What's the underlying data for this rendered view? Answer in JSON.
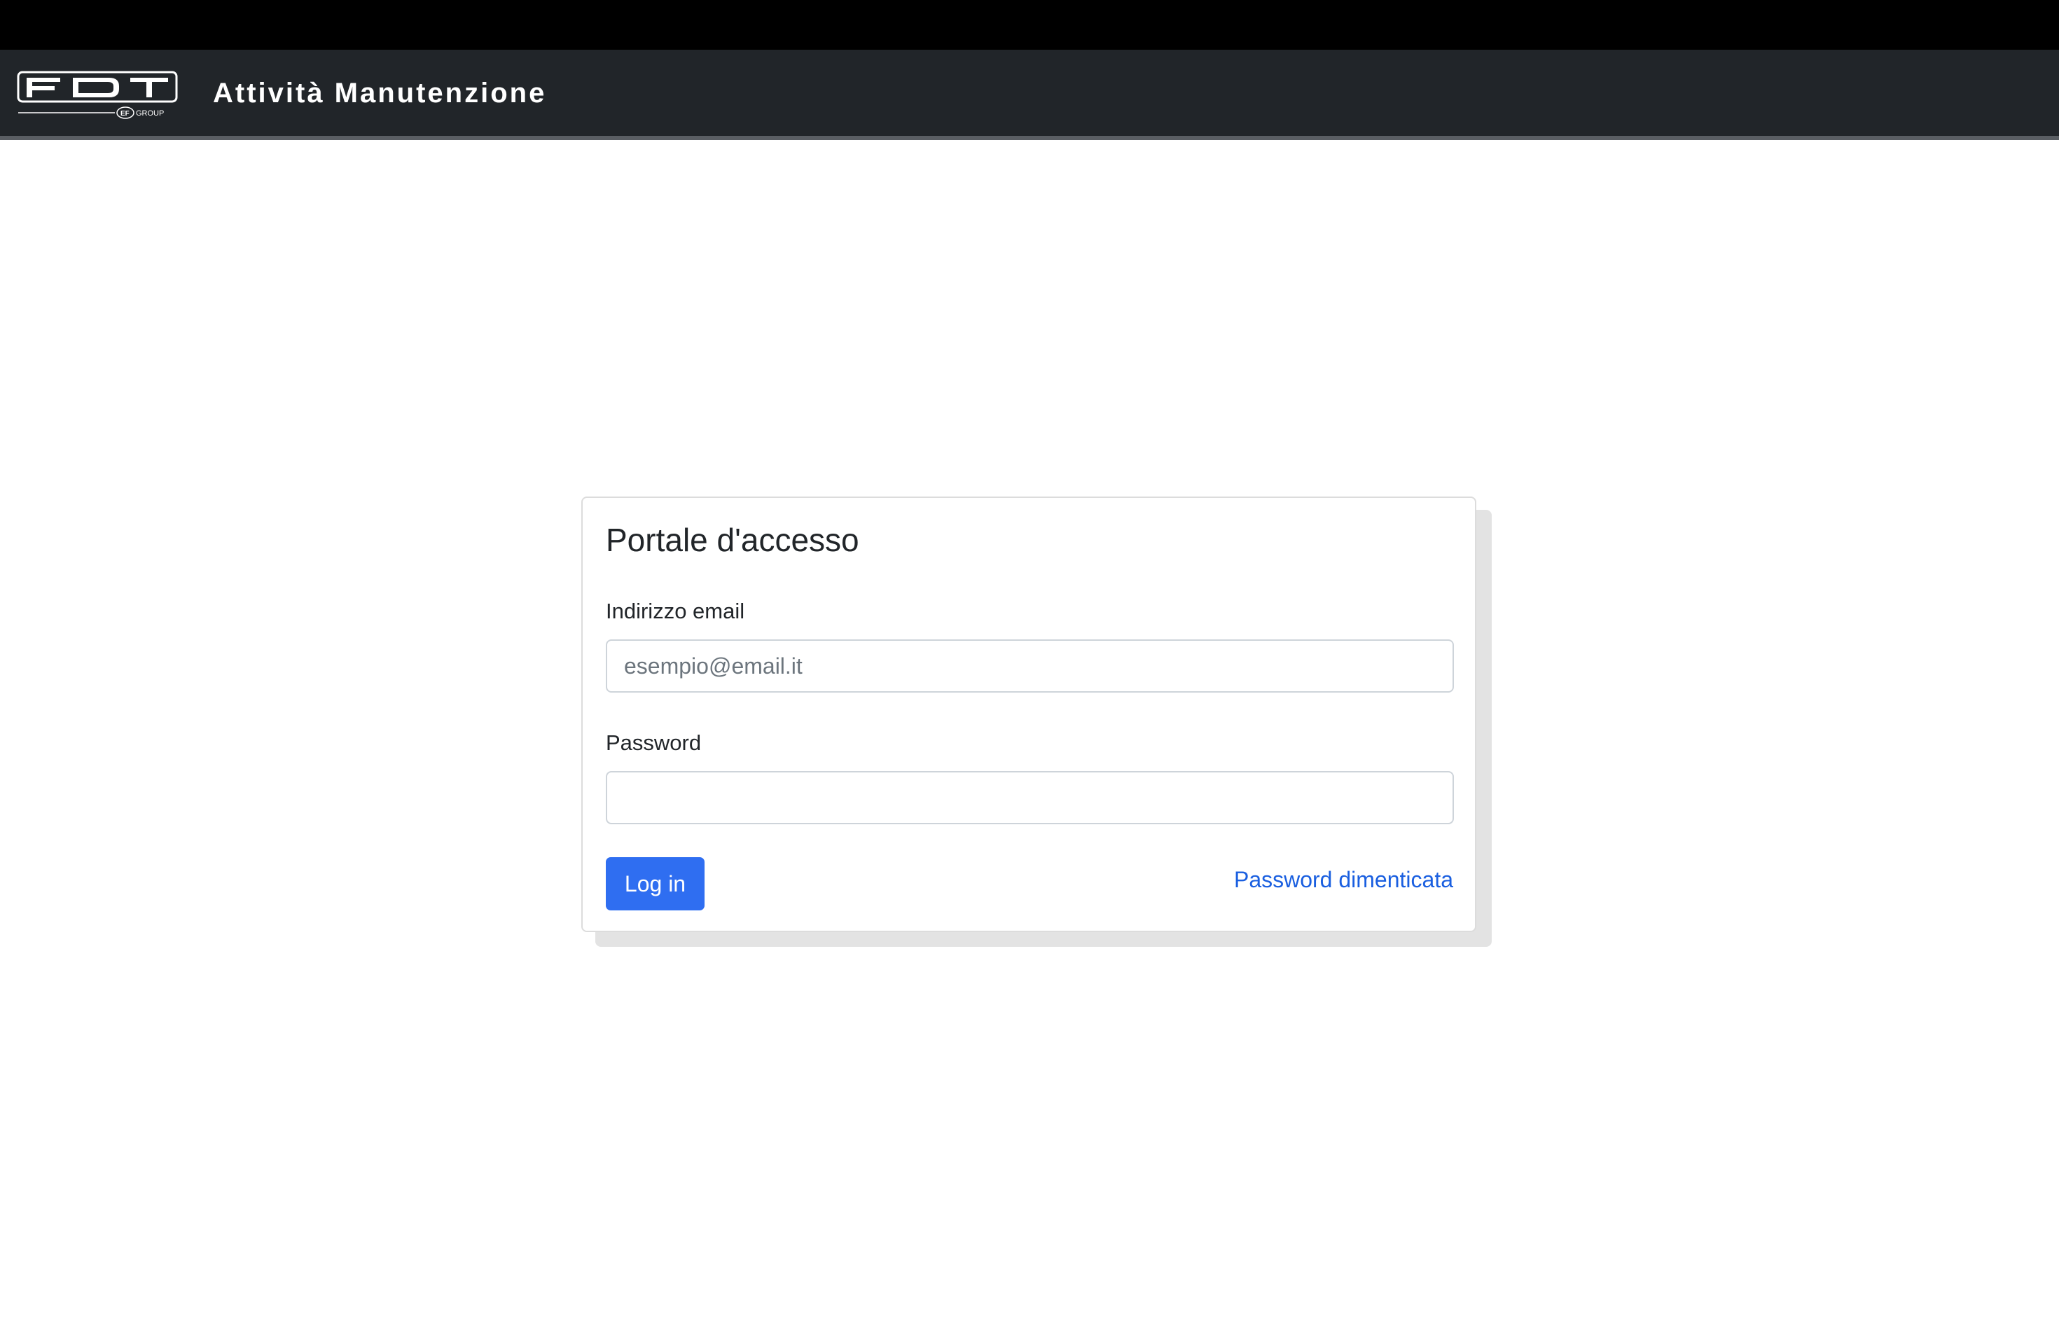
{
  "header": {
    "logo_text": "FDT",
    "logo_subtext": "EF GROUP",
    "app_title": "Attività Manutenzione"
  },
  "login_card": {
    "title": "Portale d'accesso",
    "email_label": "Indirizzo email",
    "email_placeholder": "esempio@email.it",
    "email_value": "",
    "password_label": "Password",
    "password_value": "",
    "login_button_label": "Log in",
    "forgot_password_link": "Password dimenticata"
  },
  "colors": {
    "navbar_background": "#212529",
    "top_strip": "#000000",
    "primary_button": "#2f6ef1",
    "link": "#1a5fe0"
  }
}
